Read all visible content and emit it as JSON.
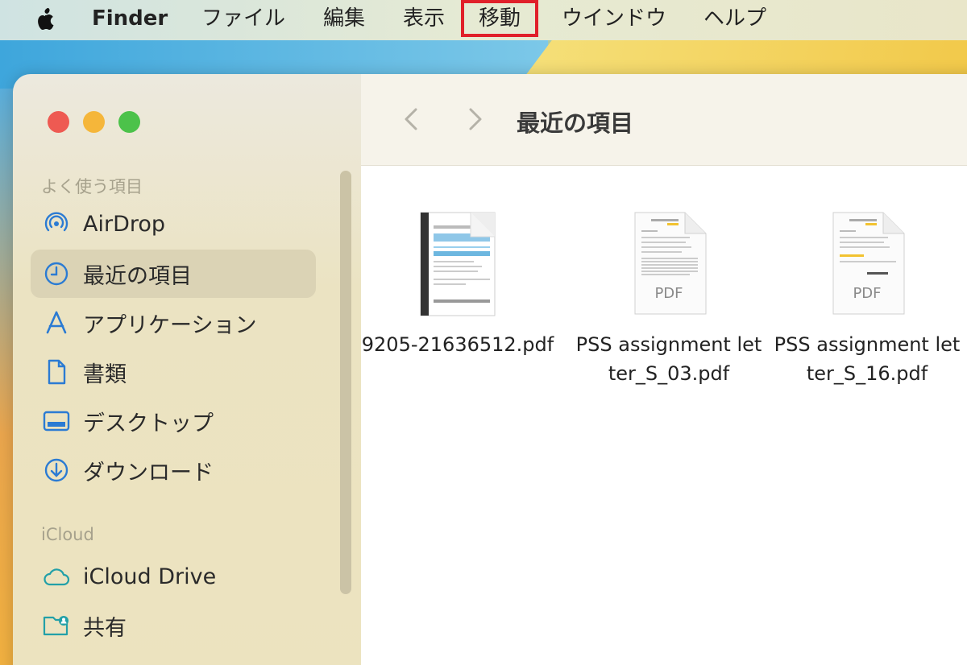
{
  "menubar": {
    "apple": "apple-logo-icon",
    "app_name": "Finder",
    "items": [
      "ファイル",
      "編集",
      "表示",
      "移動",
      "ウインドウ",
      "ヘルプ"
    ],
    "highlighted_item": "移動",
    "highlight_color": "#e0202a"
  },
  "window": {
    "title": "最近の項目",
    "traffic_colors": {
      "close": "#ee5a52",
      "minimize": "#f5b63a",
      "zoom": "#4cc24a"
    }
  },
  "sidebar": {
    "favorites_title": "よく使う項目",
    "favorites": [
      {
        "label": "AirDrop",
        "icon": "airdrop-icon"
      },
      {
        "label": "最近の項目",
        "icon": "clock-icon",
        "selected": true
      },
      {
        "label": "アプリケーション",
        "icon": "apps-icon"
      },
      {
        "label": "書類",
        "icon": "document-icon"
      },
      {
        "label": "デスクトップ",
        "icon": "desktop-icon"
      },
      {
        "label": "ダウンロード",
        "icon": "download-icon"
      }
    ],
    "icloud_title": "iCloud",
    "icloud": [
      {
        "label": "iCloud Drive",
        "icon": "cloud-icon"
      },
      {
        "label": "共有",
        "icon": "shared-folder-icon"
      }
    ]
  },
  "files": [
    {
      "name": "9205-21636512.pdf",
      "kind": "pdf-preview"
    },
    {
      "name": "PSS assignment letter_S_03.pdf",
      "kind": "pdf-doc",
      "badge": "PDF"
    },
    {
      "name": "PSS assignment letter_S_16.pdf",
      "kind": "pdf-doc",
      "badge": "PDF"
    }
  ]
}
